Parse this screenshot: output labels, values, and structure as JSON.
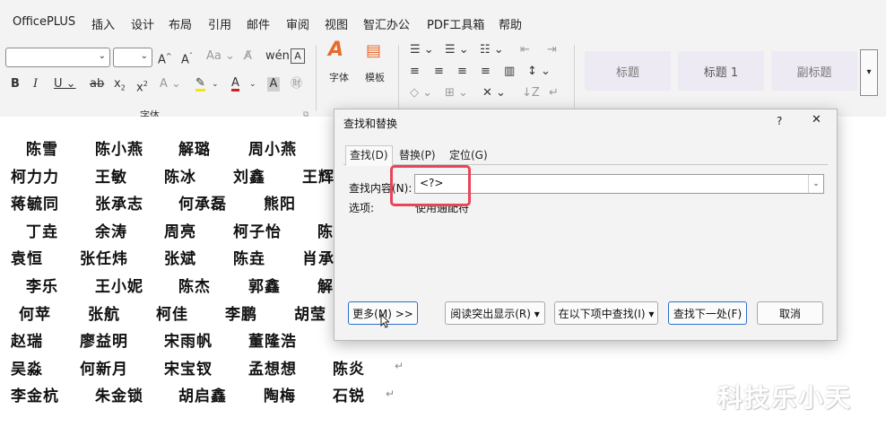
{
  "menubar": {
    "items": [
      "OfficePLUS",
      "插入",
      "设计",
      "布局",
      "引用",
      "邮件",
      "审阅",
      "视图",
      "智汇办公",
      "PDF工具箱",
      "帮助"
    ]
  },
  "ribbon": {
    "font_group_label": "字体",
    "font_button_label": "字体",
    "template_button_label": "模板",
    "styles": [
      "标题",
      "标题 1",
      "副标题"
    ]
  },
  "document": {
    "rows": [
      [
        "陈雪",
        "陈小燕",
        "解璐",
        "周小燕"
      ],
      [
        "柯力力",
        "王敏",
        "陈冰",
        "刘鑫",
        "王辉"
      ],
      [
        "蒋毓同",
        "张承志",
        "何承磊",
        "熊阳"
      ],
      [
        "丁垚",
        "余涛",
        "周亮",
        "柯子怡",
        "陈"
      ],
      [
        "袁恒",
        "张任炜",
        "张斌",
        "陈垚",
        "肖承"
      ],
      [
        "李乐",
        "王小妮",
        "陈杰",
        "郭鑫",
        "解"
      ],
      [
        "何苹",
        "张航",
        "柯佳",
        "李鹏",
        "胡莹"
      ],
      [
        "赵瑞",
        "廖益明",
        "宋雨帆",
        "董隆浩"
      ],
      [
        "吴淼",
        "何新月",
        "宋宝钗",
        "孟想想",
        "陈炎"
      ],
      [
        "李金杭",
        "朱金锁",
        "胡启鑫",
        "陶梅",
        "石锐"
      ]
    ]
  },
  "dialog": {
    "title": "查找和替换",
    "help": "?",
    "close": "✕",
    "tabs": [
      "查找(D)",
      "替换(P)",
      "定位(G)"
    ],
    "find_label": "查找内容(N):",
    "find_value": "<?>",
    "options_label": "选项:",
    "options_value": "使用通配符",
    "buttons": {
      "more": "更多(M) >>",
      "reading_highlight": "阅读突出显示(R) ▾",
      "find_in": "在以下项中查找(I) ▾",
      "find_next": "查找下一处(F)",
      "cancel": "取消"
    }
  },
  "watermark": "科技乐小天"
}
